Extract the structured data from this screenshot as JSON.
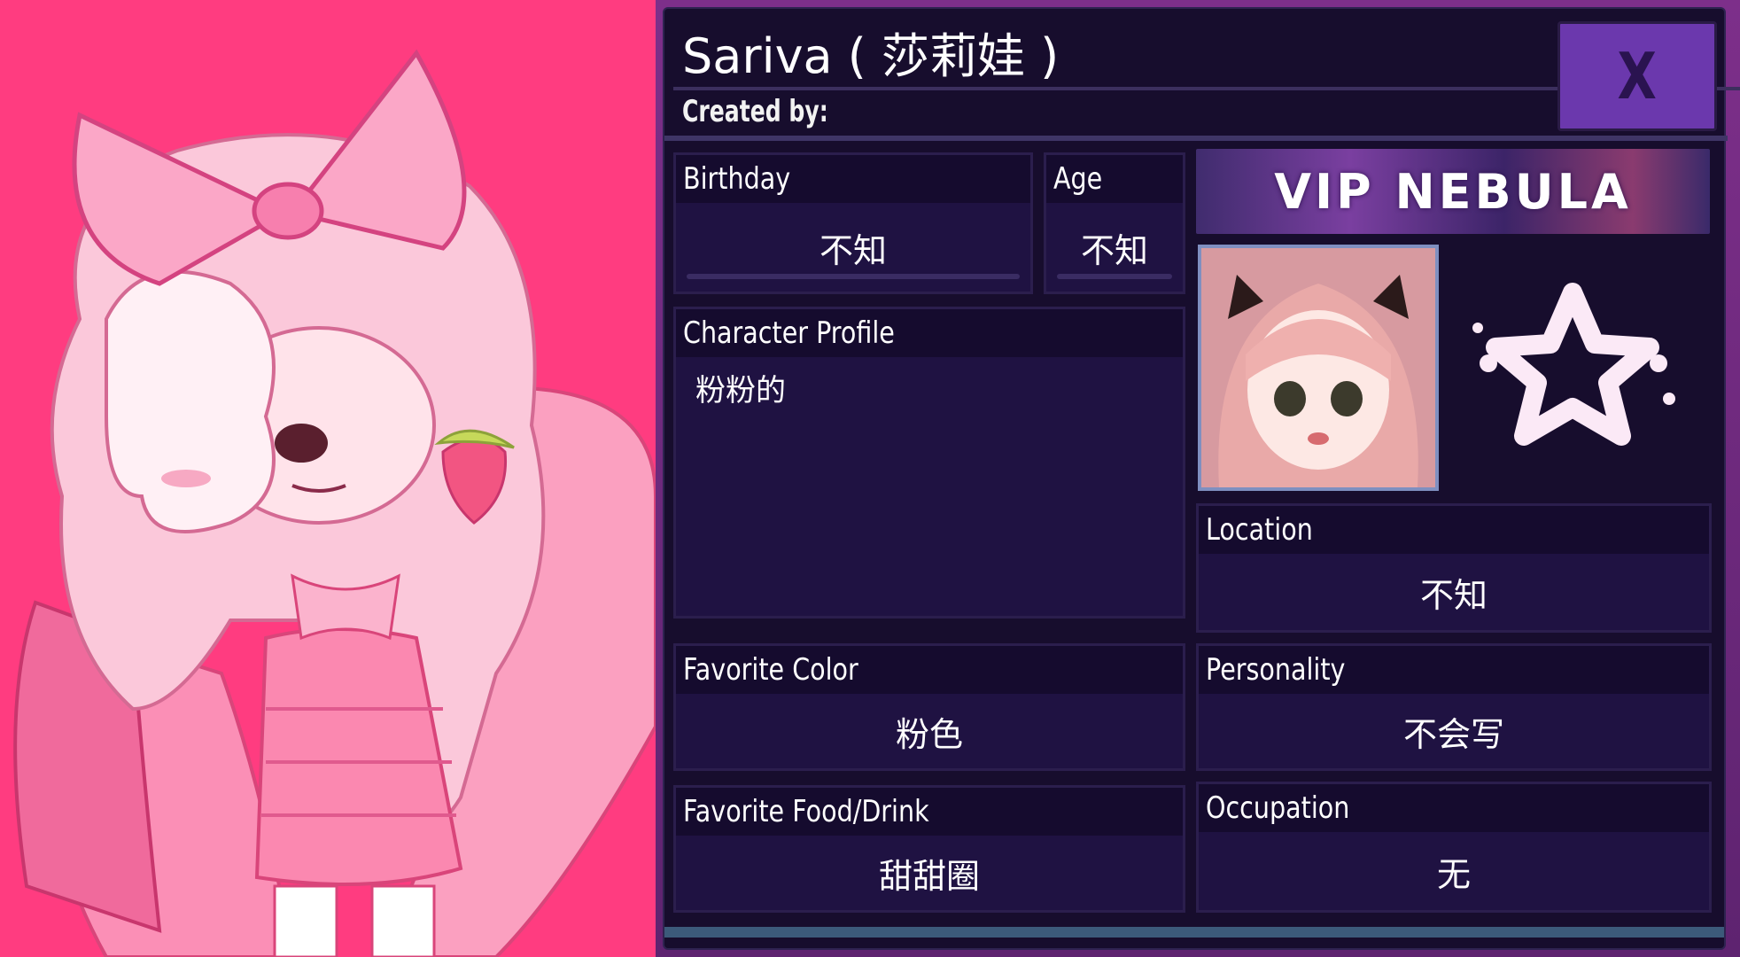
{
  "header": {
    "name": "Sariva ( 莎莉娃 )",
    "created_by": "Created by:",
    "close_label": "X"
  },
  "fields": {
    "birthday": {
      "label": "Birthday",
      "value": "不知"
    },
    "age": {
      "label": "Age",
      "value": "不知"
    },
    "profile": {
      "label": "Character Profile",
      "value": "粉粉的"
    },
    "location": {
      "label": "Location",
      "value": "不知"
    },
    "favorite_color": {
      "label": "Favorite Color",
      "value": "粉色"
    },
    "personality": {
      "label": "Personality",
      "value": "不会写"
    },
    "favorite_food": {
      "label": "Favorite Food/Drink",
      "value": "甜甜圈"
    },
    "occupation": {
      "label": "Occupation",
      "value": "无"
    }
  },
  "badge": {
    "banner_text": "VIP NEBULA"
  },
  "colors": {
    "background": "#ff3c80",
    "panel": "#170d2d",
    "close_button": "#6b38ad"
  },
  "icons": [
    "close-icon",
    "star-badge-icon",
    "bow-icon",
    "strawberry-icon"
  ]
}
